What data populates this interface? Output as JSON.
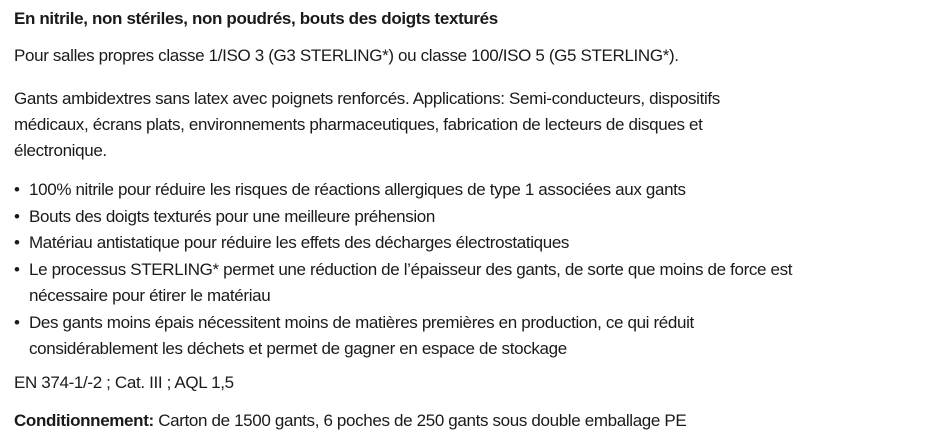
{
  "heading": "En nitrile, non stériles, non poudrés, bouts des doigts texturés",
  "cleanroom_line": "Pour salles propres classe 1/ISO 3 (G3 STERLING*) ou classe 100/ISO 5 (G5 STERLING*).",
  "description_lines": [
    "Gants ambidextres sans latex avec poignets renforcés. Applications: Semi-conducteurs, dispositifs",
    "médicaux, écrans plats, environnements pharmaceutiques, fabrication de lecteurs de disques et",
    "électronique."
  ],
  "bullet_marker": "•",
  "features": [
    {
      "lines": [
        "100% nitrile pour réduire les risques de réactions allergiques de type 1 associées aux gants"
      ]
    },
    {
      "lines": [
        "Bouts des doigts texturés pour une meilleure préhension"
      ]
    },
    {
      "lines": [
        "Matériau antistatique pour réduire les effets des décharges électrostatiques"
      ]
    },
    {
      "lines": [
        "Le processus STERLING* permet une réduction de l’épaisseur des gants, de sorte que moins de force est",
        "nécessaire pour étirer le matériau"
      ]
    },
    {
      "lines": [
        "Des gants moins épais nécessitent moins de matières premières en production, ce qui réduit",
        "considérablement les déchets et permet de gagner en espace de stockage"
      ]
    }
  ],
  "standards": "EN 374-1/-2 ; Cat. III ; AQL 1,5",
  "packaging": {
    "label": "Conditionnement:",
    "text": " Carton de 1500 gants, 6 poches de 250 gants sous double emballage PE"
  }
}
